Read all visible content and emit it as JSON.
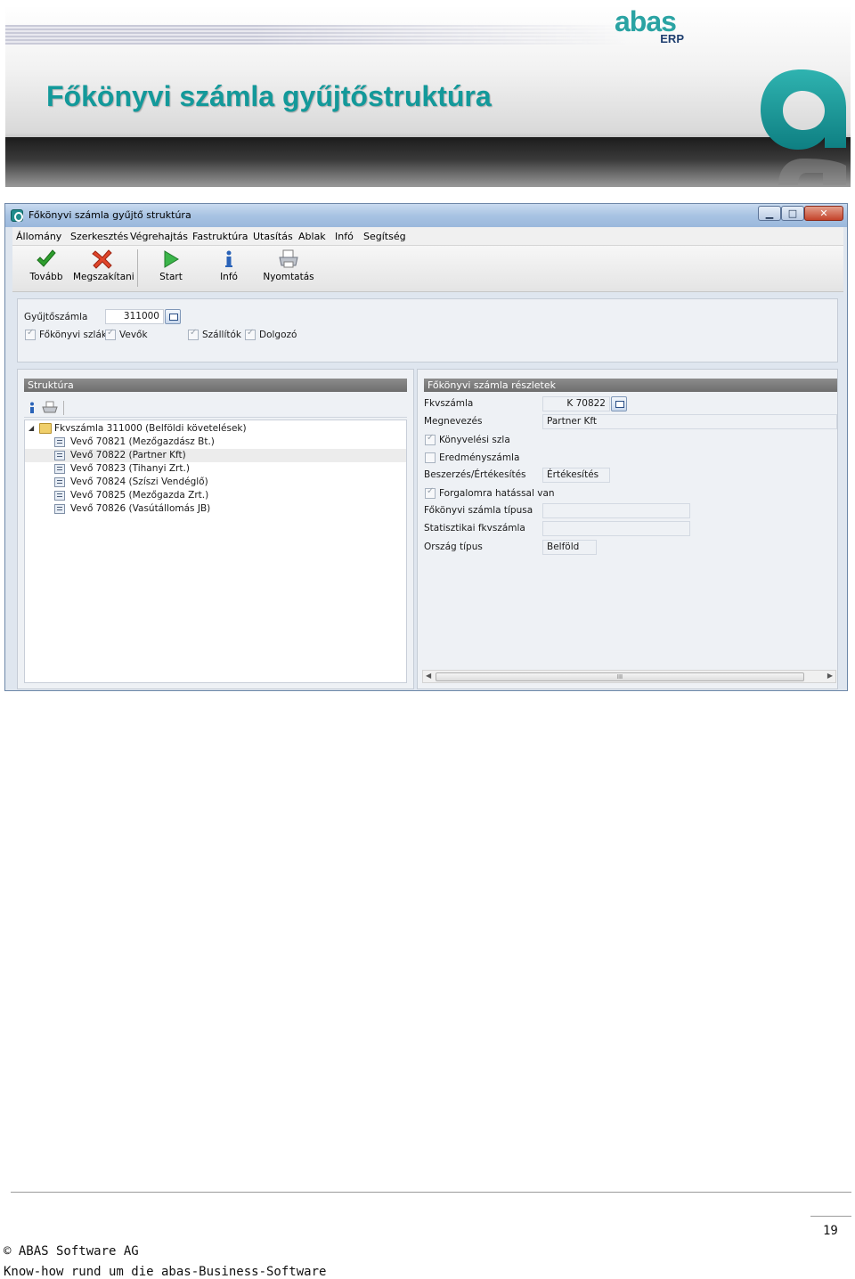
{
  "slide": {
    "title": "Főkönyvi számla gyűjtőstruktúra",
    "logo_text": "abas",
    "logo_sub": "ERP",
    "brand_color": "#13999a"
  },
  "window": {
    "title": "Főkönyvi számla gyűjtő struktúra",
    "controls": {
      "minimize": "▁",
      "maximize": "□",
      "close": "✕"
    }
  },
  "menu": [
    "Állomány",
    "Szerkesztés",
    "Végrehajtás",
    "Fastruktúra",
    "Utasítás",
    "Ablak",
    "Infó",
    "Segítség"
  ],
  "toolbar": {
    "tovabb": {
      "label": "Tovább",
      "icon": "checkmark-icon"
    },
    "megszakitani": {
      "label": "Megszakítani",
      "icon": "cancel-x-icon"
    },
    "start": {
      "label": "Start",
      "icon": "play-icon"
    },
    "info": {
      "label": "Infó",
      "icon": "info-icon"
    },
    "nyomtatas": {
      "label": "Nyomtatás",
      "icon": "printer-icon"
    }
  },
  "header_panel": {
    "gyujtoszamla_label": "Gyűjtőszámla",
    "gyujtoszamla_value": "311000",
    "checkboxes": {
      "fokonyvi": {
        "label": "Főkönyvi szlák",
        "checked": true
      },
      "vevok": {
        "label": "Vevők",
        "checked": true
      },
      "szallitok": {
        "label": "Szállítók",
        "checked": true
      },
      "dolgozo": {
        "label": "Dolgozó",
        "checked": true
      }
    }
  },
  "structure": {
    "title": "Struktúra",
    "root": "Fkvszámla 311000 (Belföldi követelések)",
    "children": [
      "Vevő 70821 (Mezőgazdász Bt.)",
      "Vevő 70822 (Partner Kft)",
      "Vevő 70823 (Tihanyi Zrt.)",
      "Vevő 70824 (Szíszi Vendéglő)",
      "Vevő 70825 (Mezőgazda Zrt.)",
      "Vevő 70826 (Vasútállomás JB)"
    ],
    "selected_index": 1
  },
  "details": {
    "title": "Főkönyvi számla részletek",
    "fkvszamla_label": "Fkvszámla",
    "fkvszamla_value": "K 70822",
    "megnevezes_label": "Megnevezés",
    "megnevezes_value": "Partner Kft",
    "konyvelesi_label": "Könyvelési szla",
    "konyvelesi_checked": true,
    "eredmeny_label": "Eredményszámla",
    "eredmeny_checked": false,
    "beszerzes_label": "Beszerzés/Értékesítés",
    "beszerzes_value": "Értékesítés",
    "forgalom_label": "Forgalomra hatással van",
    "forgalom_checked": true,
    "tipus_label": "Főkönyvi számla típusa",
    "tipus_value": "",
    "statisztikai_label": "Statisztikai fkvszámla",
    "statisztikai_value": "",
    "orszag_label": "Ország típus",
    "orszag_value": "Belföld",
    "scroll_grip": "III"
  },
  "footer": {
    "page_number": "19",
    "copyright": "© ABAS Software AG",
    "tagline": "Know-how rund um die abas-Business-Software"
  }
}
